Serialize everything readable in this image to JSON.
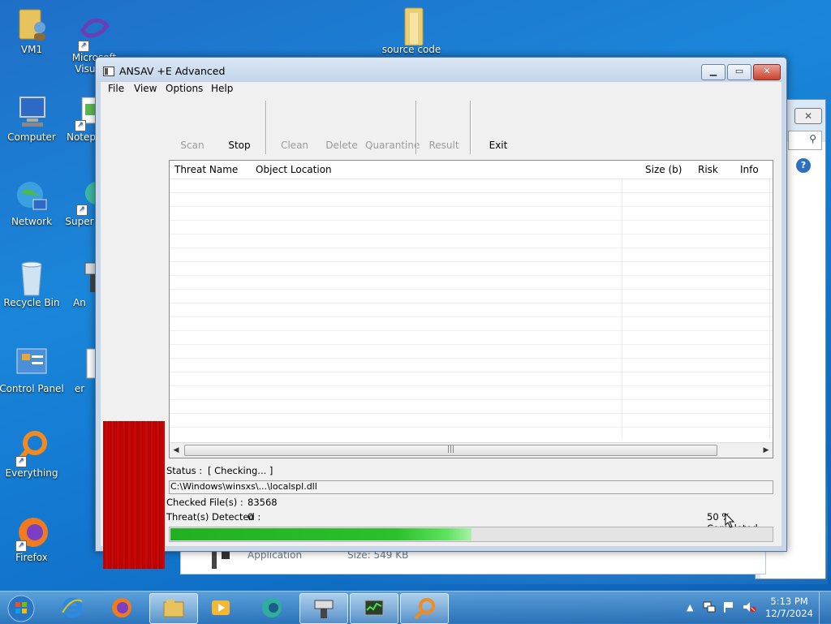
{
  "desktop": {
    "icons": [
      {
        "label": "VM1"
      },
      {
        "label": "Microsoft Visual..."
      },
      {
        "label": "source code"
      },
      {
        "label": "Computer"
      },
      {
        "label": "Notep"
      },
      {
        "label": "Network"
      },
      {
        "label": "Super"
      },
      {
        "label": "Recycle Bin"
      },
      {
        "label": "An"
      },
      {
        "label": "Control Panel"
      },
      {
        "label": "er"
      },
      {
        "label": "Everything"
      },
      {
        "label": "Firefox"
      }
    ]
  },
  "bg_window": {
    "footer_type": "Application",
    "footer_size": "Size: 549 KB"
  },
  "window": {
    "title": "ANSAV +E Advanced",
    "menu": [
      "File",
      "View",
      "Options",
      "Help"
    ],
    "toolbar": {
      "scan": "Scan",
      "stop": "Stop",
      "clean": "Clean",
      "delete": "Delete",
      "quarantine": "Quarantine",
      "result": "Result",
      "exit": "Exit"
    },
    "list": {
      "columns": [
        "Threat Name",
        "Object Location",
        "Size (b)",
        "Risk",
        "Info"
      ],
      "scroll_grip": "|||"
    },
    "status": {
      "status_label": "Status :",
      "status_value": "[ Checking... ]",
      "current_path": "C:\\Windows\\winsxs\\...\\localspl.dll",
      "checked_label": "Checked File(s) :",
      "checked_value": "83568",
      "threats_label": "Threat(s) Detected :",
      "threats_value": "0",
      "completed_text": "50 % Completed",
      "progress": 0.5
    }
  },
  "taskbar": {
    "clock_time": "5:13 PM",
    "clock_date": "12/7/2024",
    "apps": [
      "start-orb",
      "internet-explorer",
      "firefox",
      "file-explorer",
      "media-player",
      "app",
      "ansav",
      "task-manager",
      "everything"
    ]
  },
  "colors": {
    "progress_green": "#2cc02c",
    "leftbar_red": "#c90000",
    "desktop_blue": "#1a86d9"
  }
}
